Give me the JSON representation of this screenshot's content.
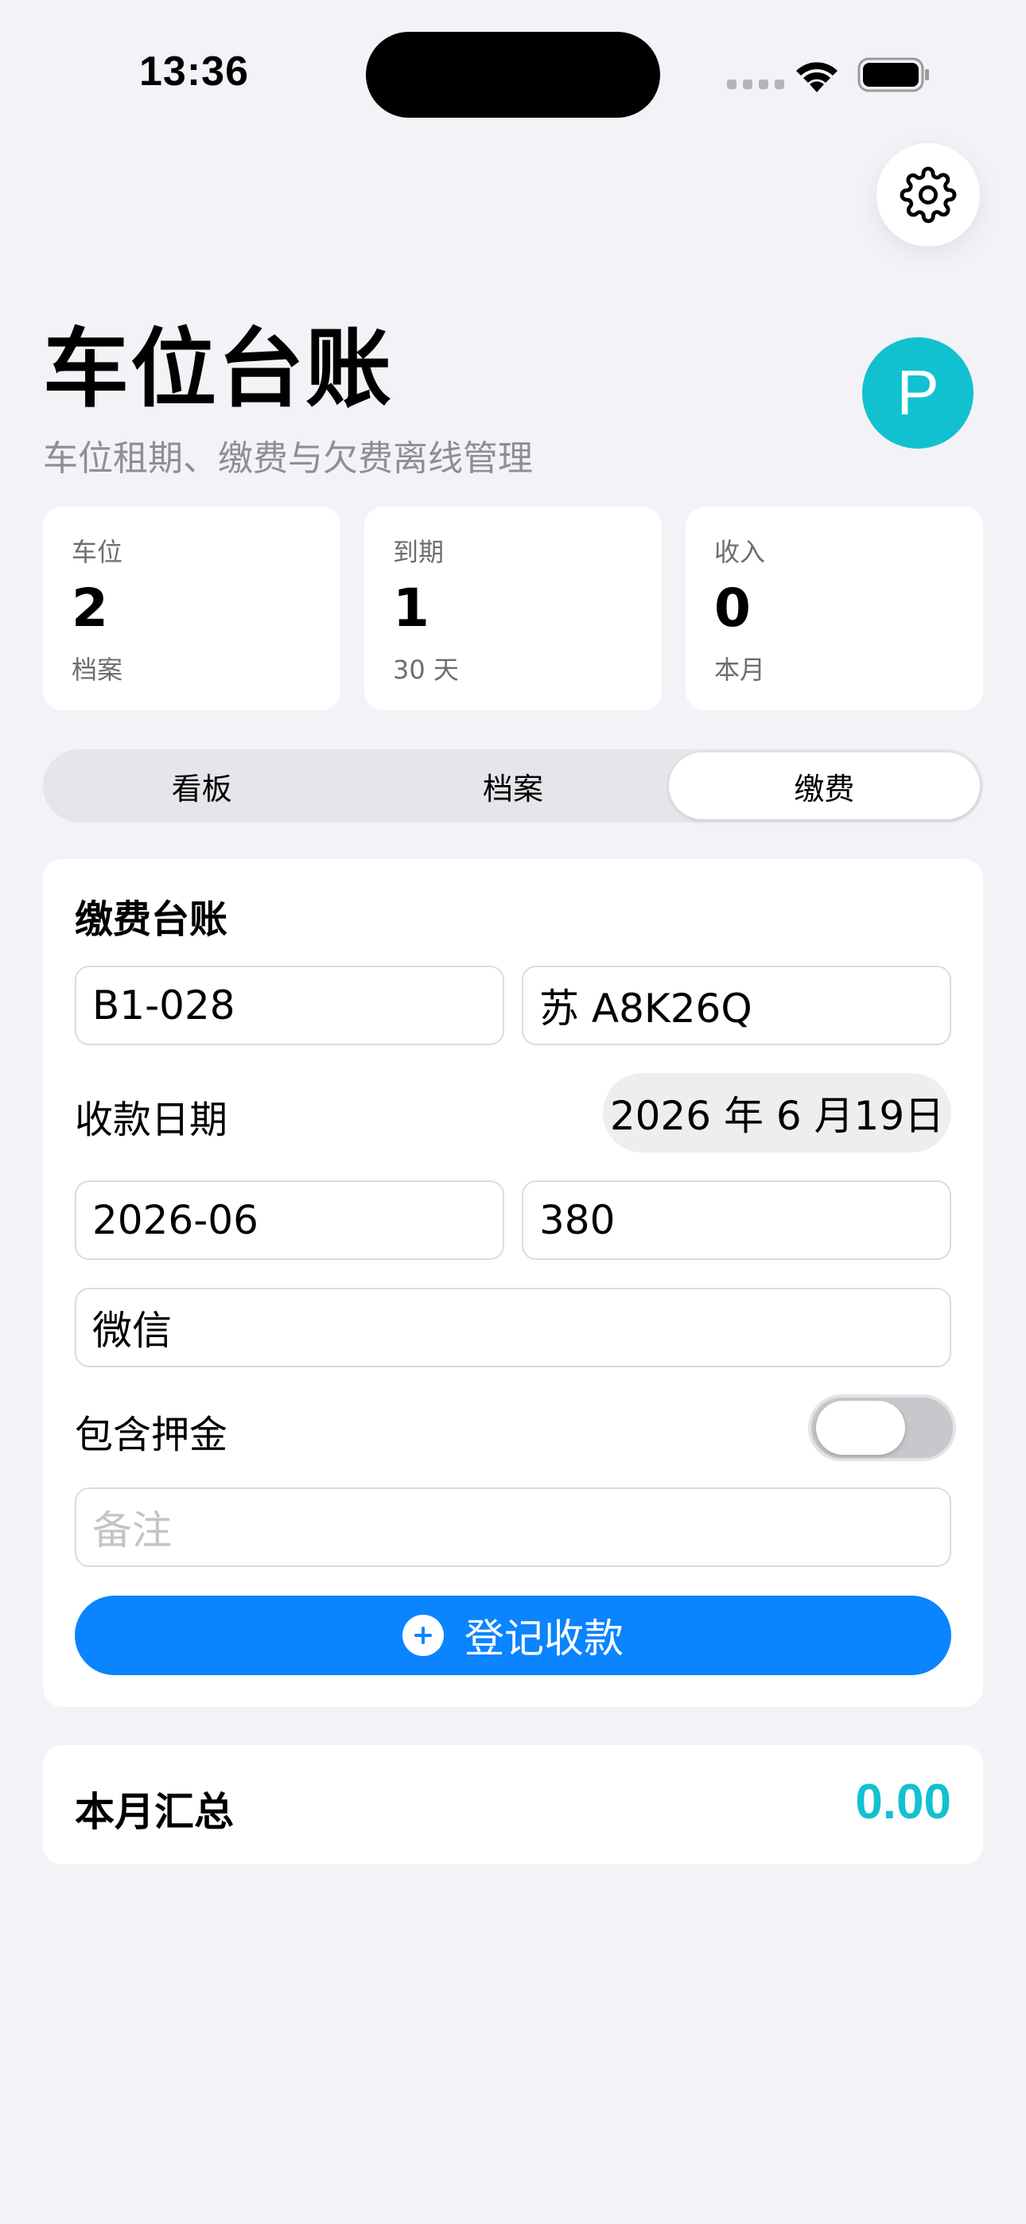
{
  "status_bar": {
    "time": "13:36"
  },
  "header": {
    "title": "车位台账",
    "subtitle": "车位租期、缴费与欠费离线管理",
    "avatar_letter": "P"
  },
  "stats": [
    {
      "label": "车位",
      "value": "2",
      "sub": "档案"
    },
    {
      "label": "到期",
      "value": "1",
      "sub": "30 天"
    },
    {
      "label": "收入",
      "value": "0",
      "sub": "本月"
    }
  ],
  "tabs": [
    {
      "label": "看板",
      "active": false
    },
    {
      "label": "档案",
      "active": false
    },
    {
      "label": "缴费",
      "active": true
    }
  ],
  "payment_form": {
    "title": "缴费台账",
    "space_no": "B1-028",
    "plate_no": "苏 A8K26Q",
    "date_label": "收款日期",
    "date_value": "2026 年 6 月19日",
    "period": "2026-06",
    "amount": "380",
    "method": "微信",
    "deposit_label": "包含押金",
    "deposit_on": false,
    "note_placeholder": "备注",
    "submit_label": "登记收款"
  },
  "summary": {
    "label": "本月汇总",
    "value": "0.00"
  },
  "colors": {
    "accent_teal": "#12c1cf",
    "primary_blue": "#0a84ff",
    "background": "#f2f2f7"
  },
  "icons": {
    "settings": "gear-icon",
    "submit": "plus-circle-icon",
    "wifi": "wifi-icon",
    "battery": "battery-icon"
  }
}
